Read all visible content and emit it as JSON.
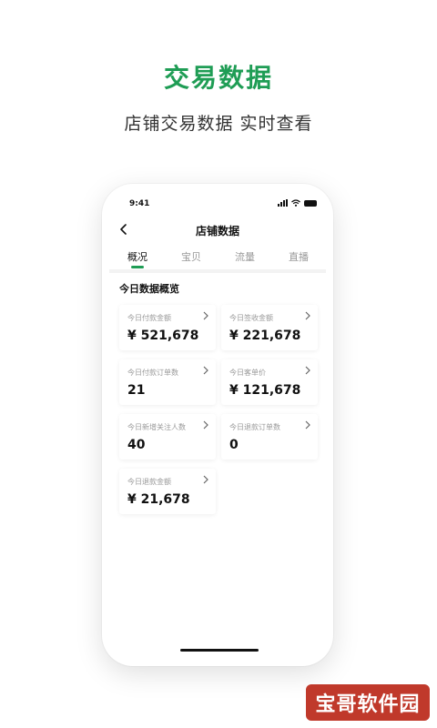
{
  "hero": {
    "title": "交易数据",
    "subtitle": "店铺交易数据 实时查看"
  },
  "status_bar": {
    "time": "9:41",
    "icons": [
      "signal-icon",
      "wifi-icon",
      "battery-icon"
    ]
  },
  "nav": {
    "back_icon": "chevron-left-icon",
    "title": "店铺数据"
  },
  "tabs": [
    {
      "label": "概况",
      "active": true
    },
    {
      "label": "宝贝",
      "active": false
    },
    {
      "label": "流量",
      "active": false
    },
    {
      "label": "直播",
      "active": false
    }
  ],
  "section": {
    "title": "今日数据概览"
  },
  "cards": [
    {
      "label": "今日付款金额",
      "value": "¥ 521,678"
    },
    {
      "label": "今日签收金额",
      "value": "¥ 221,678"
    },
    {
      "label": "今日付款订单数",
      "value": "21"
    },
    {
      "label": "今日客单价",
      "value": "¥ 121,678"
    },
    {
      "label": "今日新增关注人数",
      "value": "40"
    },
    {
      "label": "今日退款订单数",
      "value": "0"
    },
    {
      "label": "今日退款金额",
      "value": "¥ 21,678"
    }
  ],
  "watermark": {
    "text": "宝哥软件园"
  },
  "colors": {
    "accent": "#1f9d55",
    "watermark_bg": "#c0392b"
  }
}
